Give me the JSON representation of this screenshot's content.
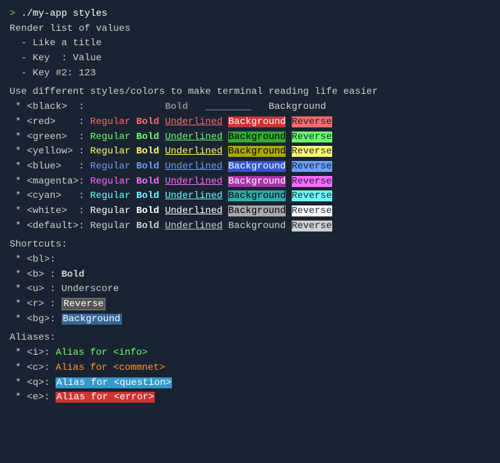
{
  "terminal": {
    "prompt": "> ./my-app styles",
    "header": [
      "Render list of values",
      "  - Like a title",
      "  - Key  : Value",
      "  - Key #2: 123"
    ],
    "description": "Use different styles/colors to make terminal reading life easier",
    "colors": [
      {
        "name": "<black>",
        "label": "black"
      },
      {
        "name": "<red>",
        "label": "red"
      },
      {
        "name": "<green>",
        "label": "green"
      },
      {
        "name": "<yellow>",
        "label": "yellow"
      },
      {
        "name": "<blue>",
        "label": "blue"
      },
      {
        "name": "<magenta>",
        "label": "magenta"
      },
      {
        "name": "<cyan>",
        "label": "cyan"
      },
      {
        "name": "<white>",
        "label": "white"
      },
      {
        "name": "<default>",
        "label": "default"
      }
    ],
    "shortcuts_title": "Shortcuts:",
    "shortcuts": [
      {
        "key": "<bl>:",
        "desc": ""
      },
      {
        "key": "<b>",
        "desc": " : ",
        "styled": "Bold"
      },
      {
        "key": "<u>",
        "desc": " : Underscore"
      },
      {
        "key": "<r>",
        "desc": " : ",
        "styled": "Reverse"
      },
      {
        "key": "<bg>:",
        "desc": " ",
        "styled": "Background"
      }
    ],
    "aliases_title": "Aliases:",
    "aliases": [
      {
        "key": "<i>:",
        "desc": "Alias for <info>",
        "color": "green"
      },
      {
        "key": "<c>:",
        "desc": "Alias for <commnet>",
        "color": "orange"
      },
      {
        "key": "<q>:",
        "desc": "Alias for <question>",
        "color": "question"
      },
      {
        "key": "<e>:",
        "desc": "Alias for <error>",
        "color": "error"
      }
    ]
  }
}
